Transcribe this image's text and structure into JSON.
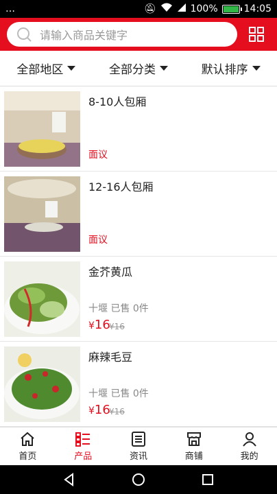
{
  "status": {
    "left": "…",
    "battery": "100%",
    "time": "14:05"
  },
  "search": {
    "placeholder": "请输入商品关键字"
  },
  "filters": [
    {
      "label": "全部地区"
    },
    {
      "label": "全部分类"
    },
    {
      "label": "默认排序"
    }
  ],
  "items": [
    {
      "name": "8-10人包厢",
      "tag": "面议"
    },
    {
      "name": "12-16人包厢",
      "tag": "面议"
    },
    {
      "name": "金芥黄瓜",
      "meta": "十堰 已售 0件",
      "currency": "¥",
      "price": "16",
      "old_price": "¥16"
    },
    {
      "name": "麻辣毛豆",
      "meta": "十堰 已售 0件",
      "currency": "¥",
      "price": "16",
      "old_price": "¥16"
    }
  ],
  "tabs": [
    {
      "label": "首页",
      "icon": "home-icon"
    },
    {
      "label": "产品",
      "icon": "list-icon",
      "active": true
    },
    {
      "label": "资讯",
      "icon": "news-icon"
    },
    {
      "label": "商铺",
      "icon": "store-icon"
    },
    {
      "label": "我的",
      "icon": "user-icon"
    }
  ],
  "colors": {
    "accent": "#e40e1f"
  }
}
